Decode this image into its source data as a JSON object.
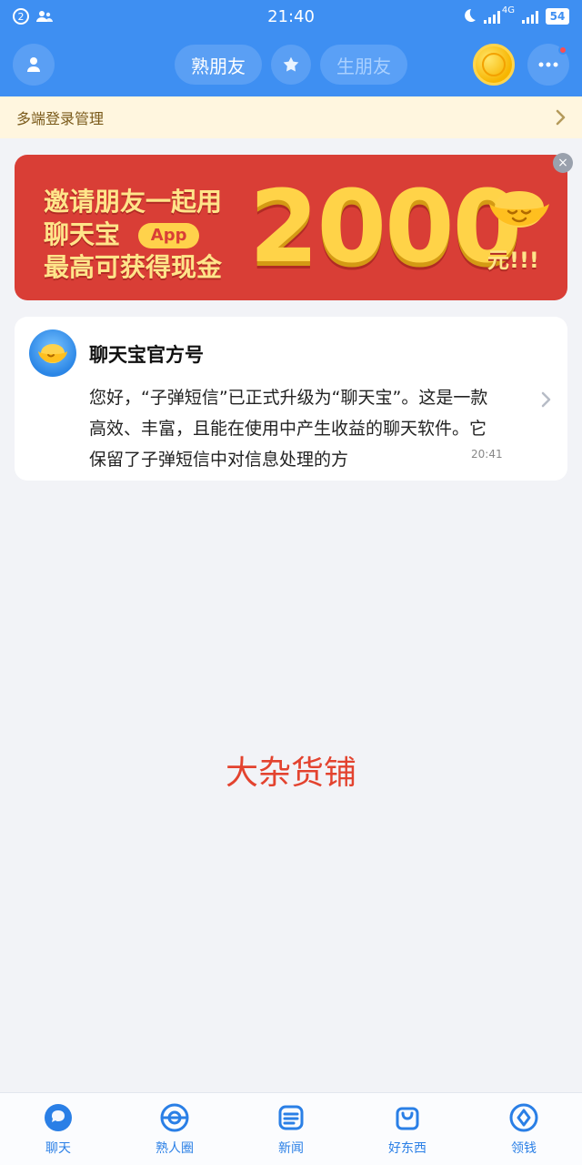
{
  "status_bar": {
    "notification_count": "2",
    "time": "21:40",
    "battery": "54",
    "network": "4G"
  },
  "header": {
    "tabs": [
      {
        "label": "熟朋友",
        "state": "active"
      },
      {
        "label": "生朋友",
        "state": "inactive"
      }
    ]
  },
  "multi_login": {
    "label": "多端登录管理"
  },
  "promo": {
    "line1": "邀请朋友一起用",
    "line2": "聊天宝",
    "chip": "App",
    "line3": "最高可获得现金",
    "amount": "2000",
    "suffix": "元!!!"
  },
  "message_card": {
    "title": "聊天宝官方号",
    "body": "您好，“子弹短信”已正式升级为“聊天宝”。这是一款高效、丰富，且能在使用中产生收益的聊天软件。它保留了子弹短信中对信息处理的方",
    "time": "20:41"
  },
  "center_label": "大杂货铺",
  "bottom_nav": [
    {
      "label": "聊天",
      "icon": "chat-icon"
    },
    {
      "label": "熟人圈",
      "icon": "circle-icon"
    },
    {
      "label": "新闻",
      "icon": "news-icon"
    },
    {
      "label": "好东西",
      "icon": "bag-icon"
    },
    {
      "label": "领钱",
      "icon": "money-icon"
    }
  ],
  "colors": {
    "primary": "#3e8ff2",
    "banner_bg": "#fff6df",
    "promo_bg": "#d93e36",
    "accent_red": "#e3432f"
  }
}
